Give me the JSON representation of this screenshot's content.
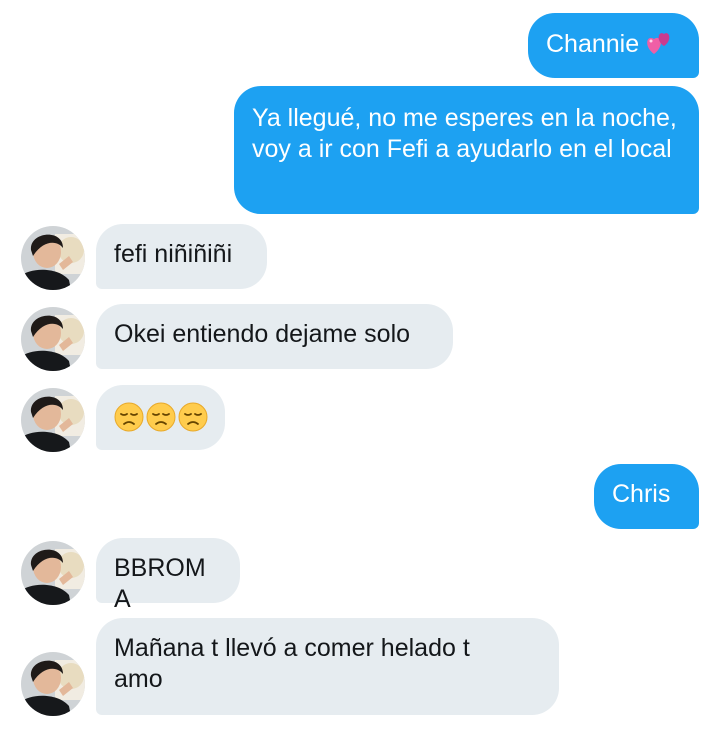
{
  "messages": [
    {
      "direction": "out",
      "text": "Channie",
      "emoji": "two-hearts-icon"
    },
    {
      "direction": "out",
      "text": "Ya llegué, no me esperes en la noche, voy a ir con Fefi a ayudarlo en el local"
    },
    {
      "direction": "in",
      "text": "fefi niñiñiñi"
    },
    {
      "direction": "in",
      "text": "Okei entiendo dejame solo"
    },
    {
      "direction": "in",
      "emojis": [
        "disappointed-face-icon",
        "disappointed-face-icon",
        "disappointed-face-icon"
      ]
    },
    {
      "direction": "out",
      "text": "Chris"
    },
    {
      "direction": "in",
      "text": "BBROMA"
    },
    {
      "direction": "in",
      "text": "Mañana t llevó a comer helado t amo"
    }
  ],
  "colors": {
    "outgoing_bubble": "#1da1f2",
    "incoming_bubble": "#e6ecf0",
    "outgoing_text": "#ffffff",
    "incoming_text": "#14171a"
  }
}
